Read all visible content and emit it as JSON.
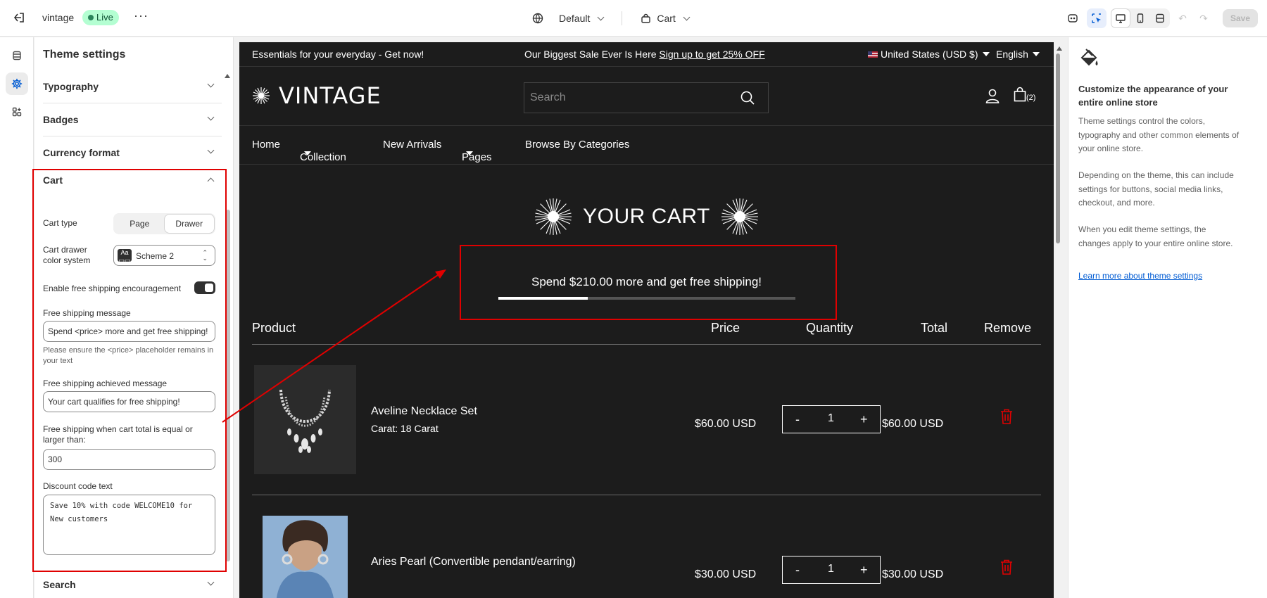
{
  "topbar": {
    "store_name": "vintage",
    "status": "Live",
    "more": "···",
    "theme": "Default",
    "template": "Cart",
    "save": "Save"
  },
  "panel": {
    "title": "Theme settings",
    "sections_top": [
      "Typography",
      "Badges",
      "Currency format"
    ],
    "cart": {
      "title": "Cart",
      "cart_type_label": "Cart type",
      "cart_type_options": [
        "Page",
        "Drawer"
      ],
      "cart_type_selected": "Drawer",
      "drawer_color_label": "Cart drawer color system",
      "drawer_color_value": "Scheme 2",
      "swatch_text": "Aa",
      "encourage_label": "Enable free shipping encouragement",
      "encourage_on": true,
      "message_label": "Free shipping message",
      "message_value": "Spend <price> more and get free shipping!",
      "message_help": "Please ensure the <price> placeholder remains in your text",
      "achieved_label": "Free shipping achieved message",
      "achieved_value": "Your cart qualifies for free shipping!",
      "threshold_label": "Free shipping when cart total is equal or larger than:",
      "threshold_value": "300",
      "discount_label": "Discount code text",
      "discount_value": "Save 10% with code WELCOME10 for New customers"
    },
    "sections_bottom": [
      "Search"
    ]
  },
  "preview": {
    "announce_left": "Essentials for your everyday - Get now!",
    "announce_center": "Our Biggest Sale Ever Is Here",
    "announce_link": "Sign up to get 25% OFF",
    "country": "United States (USD $)",
    "language": "English",
    "logo": "VINTAGE",
    "search_placeholder": "Search",
    "cart_count": "(2)",
    "nav": [
      "Home",
      "Collection",
      "New Arrivals",
      "Pages",
      "Browse By Categories"
    ],
    "cart_title": "YOUR CART",
    "shipping_message": "Spend $210.00 more and get free shipping!",
    "shipping_progress": 0.3,
    "columns": [
      "Product",
      "Price",
      "Quantity",
      "Total",
      "Remove"
    ],
    "items": [
      {
        "name": "Aveline Necklace Set",
        "variant": "Carat: 18 Carat",
        "price": "$60.00 USD",
        "qty": "1",
        "total": "$60.00 USD"
      },
      {
        "name": "Aries Pearl (Convertible pendant/earring)",
        "variant": "",
        "price": "$30.00 USD",
        "qty": "1",
        "total": "$30.00 USD"
      }
    ],
    "qty_minus": "-",
    "qty_plus": "+"
  },
  "info": {
    "heading": "Customize the appearance of your entire online store",
    "p1": "Theme settings control the colors, typography and other common elements of your online store.",
    "p2": "Depending on the theme, this can include settings for buttons, social media links, checkout, and more.",
    "p3": "When you edit theme settings, the changes apply to your entire online store.",
    "link": "Learn more about theme settings"
  },
  "colors": {
    "accent_red": "#e00000",
    "store_bg": "#1c1c1c",
    "live_badge": "#b4fed2",
    "link": "#005bd3"
  }
}
